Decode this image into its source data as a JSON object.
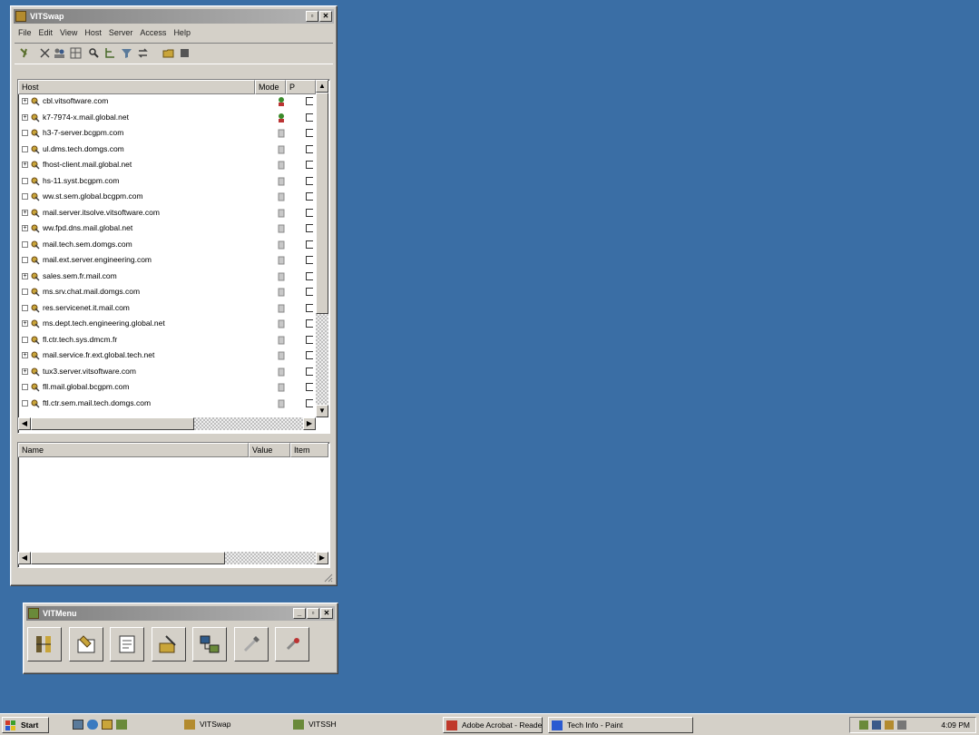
{
  "main_window": {
    "title": "VITSwap",
    "menu": [
      "File",
      "Edit",
      "View",
      "Host",
      "Server",
      "Access",
      "Help"
    ],
    "list": {
      "columns": [
        "Host",
        "Mode",
        "P"
      ],
      "rows": [
        {
          "label": "cbl.vitsoftware.com",
          "expanded": true,
          "status": "active"
        },
        {
          "label": "k7-7974-x.mail.global.net",
          "expanded": true,
          "status": "active"
        },
        {
          "label": "h3-7-server.bcgpm.com",
          "expanded": false,
          "status": "idle"
        },
        {
          "label": "ul.dms.tech.domgs.com",
          "expanded": false,
          "status": "idle"
        },
        {
          "label": "fhost-client.mail.global.net",
          "expanded": true,
          "status": "idle"
        },
        {
          "label": "hs-11.syst.bcgpm.com",
          "expanded": false,
          "status": "idle"
        },
        {
          "label": "ww.st.sem.global.bcgpm.com",
          "expanded": false,
          "status": "idle"
        },
        {
          "label": "mail.server.itsolve.vitsoftware.com",
          "expanded": true,
          "status": "idle"
        },
        {
          "label": "ww.fpd.dns.mail.global.net",
          "expanded": true,
          "status": "idle"
        },
        {
          "label": "mail.tech.sem.domgs.com",
          "expanded": false,
          "status": "idle"
        },
        {
          "label": "mail.ext.server.engineering.com",
          "expanded": false,
          "status": "idle"
        },
        {
          "label": "sales.sem.fr.mail.com",
          "expanded": true,
          "status": "idle"
        },
        {
          "label": "ms.srv.chat.mail.domgs.com",
          "expanded": false,
          "status": "idle"
        },
        {
          "label": "res.servicenet.it.mail.com",
          "expanded": false,
          "status": "idle"
        },
        {
          "label": "ms.dept.tech.engineering.global.net",
          "expanded": true,
          "status": "idle"
        },
        {
          "label": "fl.ctr.tech.sys.dmcm.fr",
          "expanded": false,
          "status": "idle"
        },
        {
          "label": "mail.service.fr.ext.global.tech.net",
          "expanded": true,
          "status": "idle"
        },
        {
          "label": "tux3.server.vitsoftware.com",
          "expanded": true,
          "status": "idle"
        },
        {
          "label": "fll.mail.global.bcgpm.com",
          "expanded": false,
          "status": "idle"
        },
        {
          "label": "ftl.ctr.sem.mail.tech.domgs.com",
          "expanded": false,
          "status": "idle"
        }
      ]
    },
    "detail": {
      "columns": [
        "Name",
        "Value",
        "Item"
      ]
    }
  },
  "launcher_window": {
    "title": "VITMenu",
    "buttons": [
      "connect-icon",
      "edit-folder-icon",
      "document-icon",
      "transfer-icon",
      "network-icon",
      "tools-icon",
      "exit-icon"
    ]
  },
  "taskbar": {
    "start_label": "Start",
    "tasks": [
      {
        "label": "VITSwap",
        "active": false
      },
      {
        "label": "VITSSH",
        "active": false
      },
      {
        "label": "Adobe Acrobat - Reader",
        "active": false
      },
      {
        "label": "Tech Info - Paint",
        "active": false
      }
    ],
    "clock": "4:09 PM"
  },
  "colors": {
    "desktop": "#3a6ea5",
    "window": "#d4d0c8",
    "titlebar_inactive": "#808080"
  }
}
